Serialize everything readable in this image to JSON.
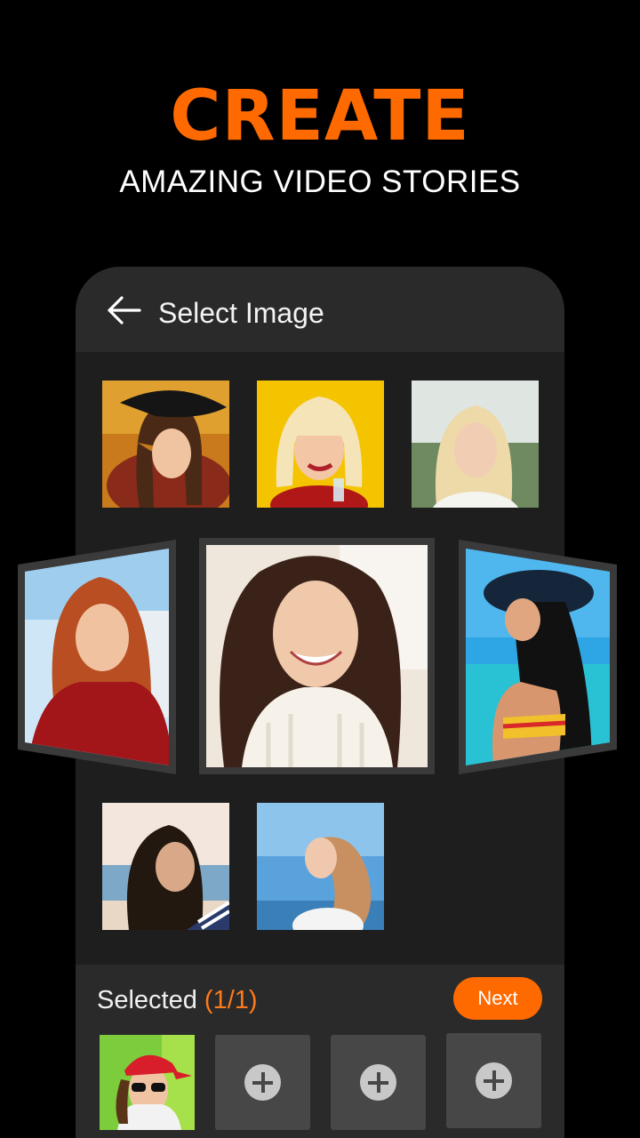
{
  "promo": {
    "headline": "CREATE",
    "subline": "AMAZING VIDEO STORIES"
  },
  "appbar": {
    "back_icon": "arrow-left-icon",
    "title": "Select Image"
  },
  "grid_photos": [
    {
      "name": "photo-woman-black-hat"
    },
    {
      "name": "photo-blonde-bob-drink"
    },
    {
      "name": "photo-blonde-outdoor"
    },
    {
      "name": "photo-woman-beach-stripes"
    },
    {
      "name": "photo-woman-sky-hair"
    }
  ],
  "carousel": {
    "left": "photo-redhead-red-shirt",
    "center": "photo-smiling-brunette-white-sweater",
    "right": "photo-woman-sunhat-beach"
  },
  "selection": {
    "label": "Selected",
    "count": "(1/1)",
    "next_label": "Next",
    "selected_photo": "photo-woman-red-cap-sunglasses",
    "add_icon": "plus-circle-icon"
  },
  "colors": {
    "accent": "#ff6a00",
    "background": "#000000",
    "panel": "#1e1e1e",
    "bar": "#2a2a2a"
  }
}
